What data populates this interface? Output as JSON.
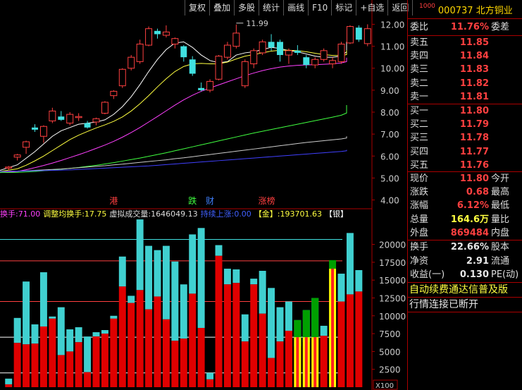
{
  "toolbar": [
    "复权",
    "叠加",
    "多股",
    "统计",
    "画线",
    "F10",
    "标记",
    "+自选",
    "返回"
  ],
  "stock": {
    "market_tag": "1000",
    "code": "000737",
    "name": "北方铜业"
  },
  "main_axis": {
    "ticks": [
      "12.00",
      "11.00",
      "10.00",
      "9.00",
      "8.00",
      "7.00",
      "6.00",
      "5.00",
      "4.00"
    ]
  },
  "peak_label": "11.99",
  "event_markers": [
    {
      "text": "港",
      "color": "#ff4040",
      "bar": 12
    },
    {
      "text": "跌",
      "color": "#40ff40",
      "bar": 21
    },
    {
      "text": "财",
      "color": "#4080ff",
      "bar": 23
    },
    {
      "text": "涨榜",
      "color": "#ff4040",
      "bar": 29
    }
  ],
  "indicator_header": {
    "turnover_label": "换手:",
    "turnover_value": "71.00",
    "adj_label": "调整均换手:",
    "adj_value": "17.75",
    "virtual_label": "虚拟成交量:",
    "virtual_value": "1646049.13",
    "cont_label": "持续上涨:",
    "cont_value": "0.00",
    "gold_label": "【金】:",
    "gold_value": "193701.63",
    "silver_label": "【银】"
  },
  "volume_axis": {
    "ticks": [
      "20000",
      "17500",
      "15000",
      "12500",
      "10000",
      "7500",
      "5000",
      "2500"
    ],
    "unit": "X100"
  },
  "chart_data": {
    "type": "candlestick",
    "ylim": [
      3.6,
      12.4
    ],
    "candles": [
      {
        "o": 5.45,
        "h": 5.55,
        "l": 5.35,
        "c": 5.5
      },
      {
        "o": 5.95,
        "h": 6.1,
        "l": 5.8,
        "c": 6.05
      },
      {
        "o": 6.4,
        "h": 6.7,
        "l": 6.1,
        "c": 6.65
      },
      {
        "o": 7.3,
        "h": 7.45,
        "l": 7.1,
        "c": 7.2
      },
      {
        "o": 6.9,
        "h": 7.4,
        "l": 6.6,
        "c": 7.35
      },
      {
        "o": 7.6,
        "h": 8.2,
        "l": 7.5,
        "c": 8.05
      },
      {
        "o": 7.8,
        "h": 8.05,
        "l": 7.6,
        "c": 7.65
      },
      {
        "o": 7.5,
        "h": 8.0,
        "l": 7.4,
        "c": 7.9
      },
      {
        "o": 7.75,
        "h": 7.95,
        "l": 7.6,
        "c": 7.8
      },
      {
        "o": 7.5,
        "h": 7.6,
        "l": 7.25,
        "c": 7.3
      },
      {
        "o": 7.55,
        "h": 7.75,
        "l": 7.4,
        "c": 7.7
      },
      {
        "o": 7.95,
        "h": 8.5,
        "l": 7.9,
        "c": 8.45
      },
      {
        "o": 8.75,
        "h": 9.0,
        "l": 8.6,
        "c": 8.95
      },
      {
        "o": 9.2,
        "h": 10.0,
        "l": 9.1,
        "c": 9.95
      },
      {
        "o": 10.0,
        "h": 10.6,
        "l": 9.9,
        "c": 10.5
      },
      {
        "o": 10.3,
        "h": 11.3,
        "l": 10.2,
        "c": 11.1
      },
      {
        "o": 11.05,
        "h": 11.9,
        "l": 11.0,
        "c": 11.8
      },
      {
        "o": 11.7,
        "h": 11.8,
        "l": 11.35,
        "c": 11.55
      },
      {
        "o": 11.5,
        "h": 11.95,
        "l": 11.4,
        "c": 11.65
      },
      {
        "o": 11.1,
        "h": 11.4,
        "l": 10.9,
        "c": 11.35
      },
      {
        "o": 11.0,
        "h": 11.05,
        "l": 10.3,
        "c": 10.5
      },
      {
        "o": 10.4,
        "h": 10.55,
        "l": 9.65,
        "c": 9.75
      },
      {
        "o": 9.1,
        "h": 9.35,
        "l": 8.95,
        "c": 9.0
      },
      {
        "o": 9.0,
        "h": 9.5,
        "l": 8.9,
        "c": 9.4
      },
      {
        "o": 9.5,
        "h": 10.6,
        "l": 9.45,
        "c": 10.55
      },
      {
        "o": 10.5,
        "h": 11.2,
        "l": 10.4,
        "c": 11.05
      },
      {
        "o": 11.0,
        "h": 11.99,
        "l": 10.9,
        "c": 11.6
      },
      {
        "o": 9.2,
        "h": 10.4,
        "l": 9.1,
        "c": 10.3
      },
      {
        "o": 10.2,
        "h": 10.9,
        "l": 10.0,
        "c": 10.8
      },
      {
        "o": 10.7,
        "h": 11.3,
        "l": 10.6,
        "c": 11.2
      },
      {
        "o": 11.2,
        "h": 11.55,
        "l": 10.8,
        "c": 10.95
      },
      {
        "o": 11.2,
        "h": 11.3,
        "l": 10.3,
        "c": 10.6
      },
      {
        "o": 10.6,
        "h": 10.9,
        "l": 10.2,
        "c": 10.8
      },
      {
        "o": 10.8,
        "h": 11.05,
        "l": 10.6,
        "c": 10.7
      },
      {
        "o": 10.5,
        "h": 10.6,
        "l": 10.0,
        "c": 10.15
      },
      {
        "o": 10.15,
        "h": 10.5,
        "l": 10.0,
        "c": 10.4
      },
      {
        "o": 10.4,
        "h": 10.9,
        "l": 10.3,
        "c": 10.8
      },
      {
        "o": 10.2,
        "h": 10.5,
        "l": 10.0,
        "c": 10.35
      },
      {
        "o": 10.3,
        "h": 11.2,
        "l": 10.2,
        "c": 11.1
      },
      {
        "o": 11.15,
        "h": 11.95,
        "l": 11.1,
        "c": 11.9
      },
      {
        "o": 11.85,
        "h": 11.95,
        "l": 11.2,
        "c": 11.3
      },
      {
        "o": 11.12,
        "h": 12.0,
        "l": 11.0,
        "c": 11.8
      }
    ],
    "volume": [
      {
        "v": 400,
        "total": 1200,
        "up": false,
        "hl": false
      },
      {
        "v": 6200,
        "total": 9700,
        "up": true,
        "hl": false
      },
      {
        "v": 6000,
        "total": 14800,
        "up": true,
        "hl": false
      },
      {
        "v": 6100,
        "total": 8800,
        "up": true,
        "hl": false
      },
      {
        "v": 8500,
        "total": 16100,
        "up": true,
        "hl": false
      },
      {
        "v": 9600,
        "total": 9900,
        "up": true,
        "hl": false
      },
      {
        "v": 4500,
        "total": 11200,
        "up": false,
        "hl": false
      },
      {
        "v": 5000,
        "total": 8100,
        "up": true,
        "hl": false
      },
      {
        "v": 6300,
        "total": 8400,
        "up": true,
        "hl": false
      },
      {
        "v": 2100,
        "total": 7100,
        "up": false,
        "hl": false
      },
      {
        "v": 7100,
        "total": 7700,
        "up": true,
        "hl": false
      },
      {
        "v": 7500,
        "total": 8000,
        "up": true,
        "hl": false
      },
      {
        "v": 9600,
        "total": 10000,
        "up": true,
        "hl": false
      },
      {
        "v": 14100,
        "total": 18300,
        "up": true,
        "hl": false
      },
      {
        "v": 11800,
        "total": 12800,
        "up": true,
        "hl": false
      },
      {
        "v": 13600,
        "total": 23500,
        "up": true,
        "hl": false
      },
      {
        "v": 10900,
        "total": 19800,
        "up": true,
        "hl": false
      },
      {
        "v": 12700,
        "total": 19200,
        "up": true,
        "hl": false
      },
      {
        "v": 9500,
        "total": 19800,
        "up": true,
        "hl": false
      },
      {
        "v": 6500,
        "total": 17600,
        "up": false,
        "hl": false
      },
      {
        "v": 6800,
        "total": 14400,
        "up": true,
        "hl": false
      },
      {
        "v": 13100,
        "total": 21400,
        "up": true,
        "hl": false
      },
      {
        "v": 8300,
        "total": 22300,
        "up": true,
        "hl": false
      },
      {
        "v": 1100,
        "total": 2000,
        "up": false,
        "hl": false
      },
      {
        "v": 18400,
        "total": 19900,
        "up": true,
        "hl": false
      },
      {
        "v": 14400,
        "total": 16600,
        "up": true,
        "hl": false
      },
      {
        "v": 14600,
        "total": 16500,
        "up": true,
        "hl": false
      },
      {
        "v": 6400,
        "total": 10200,
        "up": false,
        "hl": false
      },
      {
        "v": 14400,
        "total": 15200,
        "up": true,
        "hl": false
      },
      {
        "v": 10300,
        "total": 16300,
        "up": true,
        "hl": false
      },
      {
        "v": 4100,
        "total": 13900,
        "up": true,
        "hl": false
      },
      {
        "v": 6400,
        "total": 11200,
        "up": false,
        "hl": false
      },
      {
        "v": 7900,
        "total": 12000,
        "up": true,
        "hl": false
      },
      {
        "v": 5700,
        "total": 9400,
        "up": false,
        "hl": false
      },
      {
        "v": 6300,
        "total": 10800,
        "up": true,
        "hl": false
      },
      {
        "v": 7000,
        "total": 12500,
        "up": true,
        "hl": false
      },
      {
        "v": 7200,
        "total": 8600,
        "up": true,
        "hl": false
      },
      {
        "v": 16600,
        "total": 17800,
        "up": true,
        "hl": true
      },
      {
        "v": 12000,
        "total": 15900,
        "up": true,
        "hl": false
      },
      {
        "v": 13000,
        "total": 21600,
        "up": true,
        "hl": false
      },
      {
        "v": 13400,
        "total": 16400,
        "up": true,
        "hl": false
      }
    ],
    "ma": [
      {
        "color": "#ffffff",
        "values": [
          5.35,
          5.6,
          5.9,
          6.2,
          6.55,
          6.9,
          7.15,
          7.3,
          7.45,
          7.5,
          7.55,
          7.65,
          7.9,
          8.25,
          8.7,
          9.25,
          9.85,
          10.4,
          10.85,
          11.15,
          11.2,
          10.95,
          10.6,
          10.35,
          10.25,
          10.3,
          10.6,
          10.7,
          10.75,
          10.85,
          10.95,
          10.9,
          10.8,
          10.75,
          10.65,
          10.55,
          10.5,
          10.5,
          10.55,
          10.75,
          10.95,
          11.2
        ]
      },
      {
        "color": "#ffff40",
        "values": [
          5.3,
          5.42,
          5.58,
          5.78,
          6.0,
          6.25,
          6.5,
          6.75,
          6.95,
          7.12,
          7.28,
          7.42,
          7.58,
          7.78,
          8.05,
          8.38,
          8.75,
          9.15,
          9.52,
          9.85,
          10.08,
          10.2,
          10.22,
          10.2,
          10.2,
          10.28,
          10.42,
          10.55,
          10.62,
          10.7,
          10.78,
          10.82,
          10.82,
          10.8,
          10.75,
          10.68,
          10.62,
          10.58,
          10.58,
          10.62,
          10.7,
          10.82
        ]
      },
      {
        "color": "#ff40ff",
        "values": [
          5.25,
          5.3,
          5.38,
          5.47,
          5.57,
          5.68,
          5.8,
          5.93,
          6.06,
          6.2,
          6.35,
          6.5,
          6.67,
          6.86,
          7.07,
          7.3,
          7.55,
          7.8,
          8.06,
          8.32,
          8.56,
          8.77,
          8.95,
          9.1,
          9.24,
          9.38,
          9.52,
          9.66,
          9.78,
          9.89,
          9.98,
          10.05,
          10.1,
          10.13,
          10.15,
          10.16,
          10.18,
          10.2,
          10.24,
          10.3,
          10.38,
          10.48
        ]
      },
      {
        "color": "#40ff40",
        "values": [
          5.25,
          5.26,
          5.28,
          5.3,
          5.33,
          5.36,
          5.4,
          5.44,
          5.48,
          5.53,
          5.58,
          5.64,
          5.7,
          5.77,
          5.84,
          5.91,
          5.99,
          6.07,
          6.15,
          6.24,
          6.33,
          6.42,
          6.51,
          6.6,
          6.69,
          6.78,
          6.87,
          6.96,
          7.05,
          7.13,
          7.21,
          7.29,
          7.37,
          7.45,
          7.53,
          7.61,
          7.69,
          7.77,
          7.86,
          7.96,
          8.06,
          8.32
        ]
      },
      {
        "color": "#cccccc",
        "values": [
          5.3,
          5.31,
          5.33,
          5.35,
          5.37,
          5.39,
          5.41,
          5.44,
          5.47,
          5.5,
          5.53,
          5.56,
          5.6,
          5.63,
          5.67,
          5.71,
          5.75,
          5.79,
          5.83,
          5.88,
          5.92,
          5.97,
          6.02,
          6.07,
          6.12,
          6.17,
          6.22,
          6.27,
          6.32,
          6.37,
          6.42,
          6.47,
          6.52,
          6.57,
          6.62,
          6.66,
          6.7,
          6.74,
          6.78,
          6.82,
          6.86,
          6.9
        ]
      },
      {
        "color": "#4040ff",
        "values": [
          5.3,
          5.31,
          5.32,
          5.33,
          5.34,
          5.35,
          5.36,
          5.37,
          5.39,
          5.41,
          5.43,
          5.45,
          5.47,
          5.49,
          5.51,
          5.53,
          5.55,
          5.58,
          5.61,
          5.64,
          5.67,
          5.7,
          5.73,
          5.76,
          5.79,
          5.82,
          5.85,
          5.88,
          5.91,
          5.94,
          5.97,
          6.0,
          6.03,
          6.06,
          6.09,
          6.12,
          6.15,
          6.18,
          6.21,
          6.24,
          6.26,
          6.28
        ]
      }
    ]
  },
  "quote": {
    "weibi": {
      "label": "委比",
      "value": "11.76%",
      "label2": "委差"
    },
    "sell": [
      {
        "label": "卖五",
        "price": "11.85"
      },
      {
        "label": "卖四",
        "price": "11.84"
      },
      {
        "label": "卖三",
        "price": "11.83"
      },
      {
        "label": "卖二",
        "price": "11.82"
      },
      {
        "label": "卖一",
        "price": "11.81"
      }
    ],
    "buy": [
      {
        "label": "买一",
        "price": "11.80"
      },
      {
        "label": "买二",
        "price": "11.79"
      },
      {
        "label": "买三",
        "price": "11.78"
      },
      {
        "label": "买四",
        "price": "11.77"
      },
      {
        "label": "买五",
        "price": "11.76"
      }
    ],
    "stats1": [
      {
        "k": "现价",
        "v": "11.80",
        "k2": "今开",
        "cls": "red"
      },
      {
        "k": "涨跌",
        "v": "0.68",
        "k2": "最高",
        "cls": "red"
      },
      {
        "k": "涨幅",
        "v": "6.12%",
        "k2": "最低",
        "cls": "red"
      },
      {
        "k": "总量",
        "v": "164.6万",
        "k2": "量比",
        "cls": "yel"
      },
      {
        "k": "外盘",
        "v": "869484",
        "k2": "内盘",
        "cls": "red"
      }
    ],
    "stats2": [
      {
        "k": "换手",
        "v": "22.66%",
        "k2": "股本",
        "cls": "wht"
      },
      {
        "k": "净资",
        "v": "2.91",
        "k2": "流通",
        "cls": "wht"
      },
      {
        "k": "收益(一)",
        "v": "0.130",
        "k2": "PE(动)",
        "cls": "wht"
      }
    ],
    "notice1": "自动续费通达信普及版",
    "notice2": "行情连接已断开"
  }
}
